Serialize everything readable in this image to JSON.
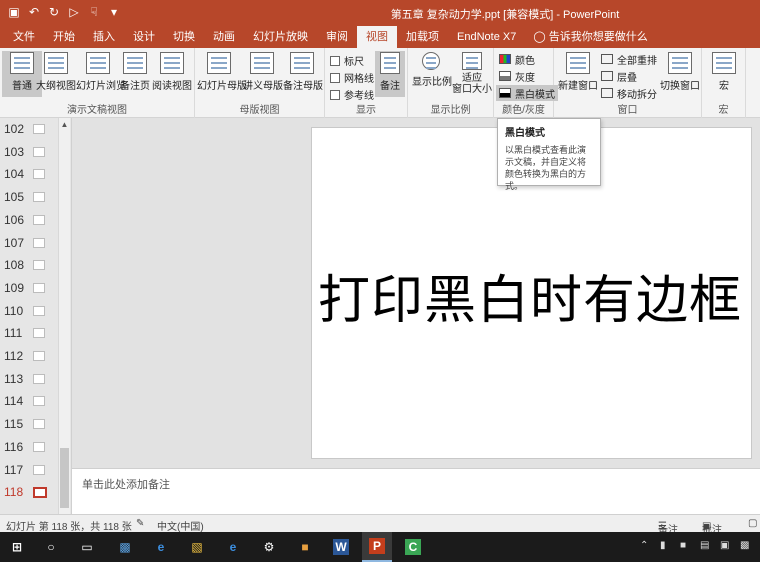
{
  "titlebar": {
    "title": "第五章 复杂动力学.ppt [兼容模式] - PowerPoint",
    "qat_icons": [
      "save-icon",
      "undo-icon",
      "redo-icon",
      "present-icon",
      "touch-mode-icon",
      "customize-icon"
    ]
  },
  "tabs": [
    "文件",
    "开始",
    "插入",
    "设计",
    "切换",
    "动画",
    "幻灯片放映",
    "审阅",
    "视图",
    "加载项",
    "EndNote X7"
  ],
  "active_tab": "视图",
  "tell_me": "告诉我你想要做什么",
  "ribbon": {
    "presentation_views": {
      "label": "演示文稿视图",
      "buttons": [
        "普通",
        "大纲视图",
        "幻灯片浏览",
        "备注页",
        "阅读视图"
      ]
    },
    "master_views": {
      "label": "母版视图",
      "buttons": [
        "幻灯片母版",
        "讲义母版",
        "备注母版"
      ]
    },
    "show": {
      "label": "显示",
      "checks": [
        "标尺",
        "网格线",
        "参考线"
      ],
      "notes": "备注"
    },
    "zoom": {
      "label": "显示比例",
      "buttons": [
        "显示比例",
        "适应\n窗口大小"
      ]
    },
    "color": {
      "label": "颜色/灰度",
      "options": [
        "颜色",
        "灰度",
        "黑白模式"
      ]
    },
    "window": {
      "label": "窗口",
      "new_window": "新建窗口",
      "small": [
        "全部重排",
        "层叠",
        "移动拆分"
      ],
      "switch": "切换窗口"
    },
    "macro": {
      "label": "宏",
      "button": "宏"
    }
  },
  "tooltip": {
    "title": "黑白模式",
    "body": "以黑白模式查看此演示文稿，并自定义将颜色转换为黑白的方式。"
  },
  "slides": [
    "102",
    "103",
    "104",
    "105",
    "106",
    "107",
    "108",
    "109",
    "110",
    "111",
    "112",
    "113",
    "114",
    "115",
    "116",
    "117",
    "118"
  ],
  "current_slide": "118",
  "slide_text": "打印黑白时有边框",
  "notes_placeholder": "单击此处添加备注",
  "status": {
    "slide_info": "幻灯片 第 118 张，共 118 张",
    "language": "中文(中国)",
    "notes": "备注",
    "comments": "批注"
  },
  "colors": {
    "accent": "#b7472a",
    "current_slide": "#c0392b"
  },
  "taskbar_icons": [
    "windows-start-icon",
    "cortana-icon",
    "task-view-icon",
    "folder-app-icon",
    "edge-icon",
    "file-explorer-icon",
    "ie-icon",
    "settings-icon",
    "app-icon",
    "word-icon",
    "powerpoint-icon",
    "camtasia-icon"
  ]
}
